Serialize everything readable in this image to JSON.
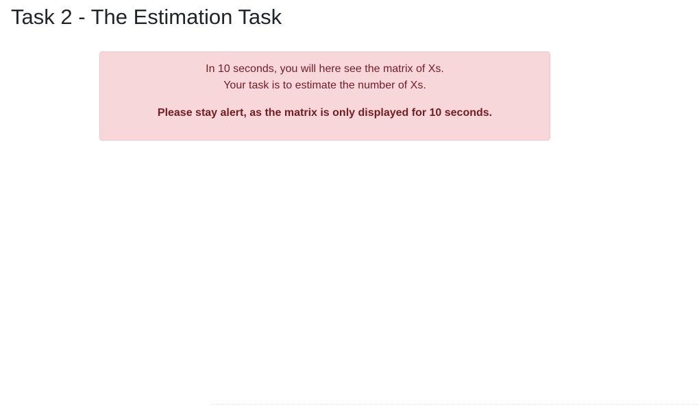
{
  "page": {
    "title": "Task 2 - The Estimation Task"
  },
  "alert": {
    "line1": "In 10 seconds, you will here see the matrix of Xs.",
    "line2": "Your task is to estimate the number of Xs.",
    "emphasis": "Please stay alert, as the matrix is only displayed for 10 seconds.",
    "colors": {
      "background": "#f8d7da",
      "border": "#f5c6cb",
      "text": "#721c24"
    }
  }
}
